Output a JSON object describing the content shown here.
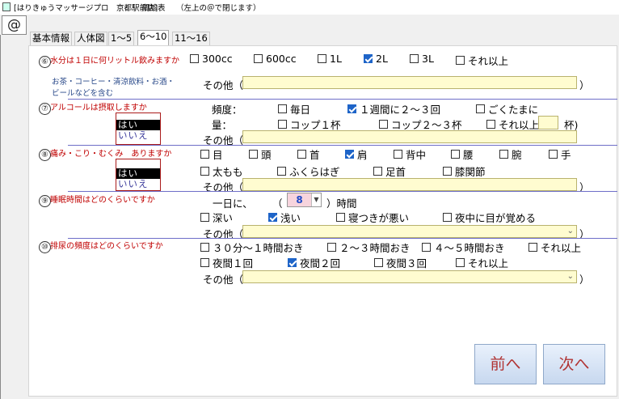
{
  "window": {
    "app_title": "[はりきゅうマッサージプロ　京都駅前店]",
    "screen": "問診表",
    "hint": "（左上の＠で閉じます）",
    "close_label": "@"
  },
  "tabs": [
    {
      "label": "基本情報",
      "active": false
    },
    {
      "label": "人体図",
      "active": false
    },
    {
      "label": "1～5",
      "active": false
    },
    {
      "label": "6～10",
      "active": true
    },
    {
      "label": "11～16",
      "active": false
    }
  ],
  "common": {
    "other_label": "その他（",
    "close_paren": "）"
  },
  "q6": {
    "number": "⑥",
    "question": "水分は１日に何リットル飲みますか",
    "note_line1": "お茶・コーヒー・清涼飲料・お酒・",
    "note_line2": "ビールなどを含む",
    "options": [
      {
        "label": "300cc",
        "checked": false
      },
      {
        "label": "600cc",
        "checked": false
      },
      {
        "label": "1L",
        "checked": false
      },
      {
        "label": "2L",
        "checked": true
      },
      {
        "label": "3L",
        "checked": false
      },
      {
        "label": "それ以上",
        "checked": false
      }
    ],
    "other_value": ""
  },
  "q7": {
    "number": "⑦",
    "question": "アルコールは摂取しますか",
    "answer_options": [
      "はい",
      "いいえ"
    ],
    "answer_selected": "はい",
    "frequency_label": "頻度：",
    "frequency": [
      {
        "label": "毎日",
        "checked": false
      },
      {
        "label": "１週間に２～３回",
        "checked": true
      },
      {
        "label": "ごくたまに",
        "checked": false
      }
    ],
    "amount_label": "量：",
    "amount": [
      {
        "label": "コップ１杯",
        "checked": false
      },
      {
        "label": "コップ２～３杯",
        "checked": false
      },
      {
        "label": "それ以上",
        "checked": false
      }
    ],
    "cups_value": "",
    "cups_unit": "杯)",
    "other_value": ""
  },
  "q8": {
    "number": "⑧",
    "question": "痛み・こり・むくみ　ありますか",
    "answer_options": [
      "はい",
      "いいえ"
    ],
    "answer_selected": "はい",
    "parts": [
      {
        "label": "目",
        "checked": false
      },
      {
        "label": "頭",
        "checked": false
      },
      {
        "label": "首",
        "checked": false
      },
      {
        "label": "肩",
        "checked": true
      },
      {
        "label": "背中",
        "checked": false
      },
      {
        "label": "腰",
        "checked": false
      },
      {
        "label": "腕",
        "checked": false
      },
      {
        "label": "手",
        "checked": false
      },
      {
        "label": "太もも",
        "checked": false
      },
      {
        "label": "ふくらはぎ",
        "checked": false
      },
      {
        "label": "足首",
        "checked": false
      },
      {
        "label": "膝関節",
        "checked": false
      }
    ],
    "other_value": ""
  },
  "q9": {
    "number": "⑨",
    "question": "睡眠時間はどのくらいですか",
    "per_day_label": "一日に、",
    "open_paren": "（",
    "hours_value": "8",
    "hours_unit": "）時間",
    "quality": [
      {
        "label": "深い",
        "checked": false
      },
      {
        "label": "浅い",
        "checked": true
      },
      {
        "label": "寝つきが悪い",
        "checked": false
      },
      {
        "label": "夜中に目が覚める",
        "checked": false
      }
    ],
    "other_value": ""
  },
  "q10": {
    "number": "⑩",
    "question": "排尿の頻度はどのくらいですか",
    "day": [
      {
        "label": "３０分～１時間おき",
        "checked": false
      },
      {
        "label": "２～３時間おき",
        "checked": false
      },
      {
        "label": "４～５時間おき",
        "checked": false
      },
      {
        "label": "それ以上",
        "checked": false
      }
    ],
    "night": [
      {
        "label": "夜間１回",
        "checked": false
      },
      {
        "label": "夜間２回",
        "checked": true
      },
      {
        "label": "夜間３回",
        "checked": false
      },
      {
        "label": "それ以上",
        "checked": false
      }
    ],
    "other_value": ""
  },
  "nav": {
    "prev_label": "前へ",
    "next_label": "次へ"
  }
}
